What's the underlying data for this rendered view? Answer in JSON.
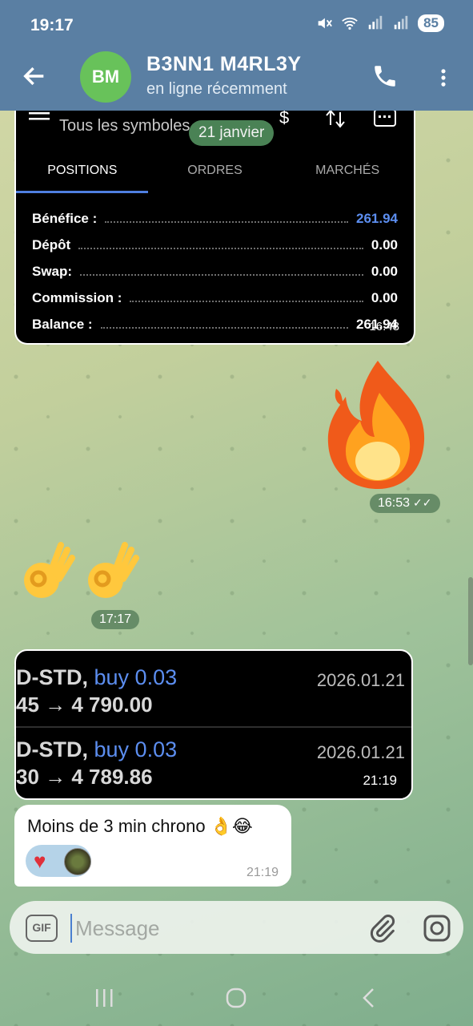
{
  "status_bar": {
    "time": "19:17",
    "battery": "85"
  },
  "header": {
    "avatar_initials": "BM",
    "name": "B3NN1 M4RL3Y",
    "status": "en ligne récemment"
  },
  "date_divider": "21 janvier",
  "message1": {
    "symbols_label": "Tous les symboles",
    "tabs": [
      "POSITIONS",
      "ORDRES",
      "MARCHÉS"
    ],
    "rows": [
      {
        "label": "Bénéfice :",
        "value": "261.94"
      },
      {
        "label": "Dépôt",
        "value": "0.00"
      },
      {
        "label": "Swap:",
        "value": "0.00"
      },
      {
        "label": "Commission :",
        "value": "0.00"
      },
      {
        "label": "Balance :",
        "value": "261.94"
      }
    ],
    "time": "16:48"
  },
  "message_fire": {
    "time": "16:53"
  },
  "message_ok": {
    "time": "17:17"
  },
  "message2": {
    "trades": [
      {
        "symbol": "D-STD,",
        "action": "buy 0.03",
        "date": "2026.01.21",
        "price": "45 → 4 790.00"
      },
      {
        "symbol": "D-STD,",
        "action": "buy 0.03",
        "date": "2026.01.21",
        "price": "30 → 4 789.86"
      }
    ],
    "time": "21:19"
  },
  "message3": {
    "text": "Moins de 3 min chrono 👌😂",
    "time": "21:19"
  },
  "input": {
    "placeholder": "Message",
    "gif_label": "GIF"
  },
  "colors": {
    "header": "#5a7fa3",
    "avatar": "#68c25a",
    "accent_blue": "#5c8ef0"
  }
}
